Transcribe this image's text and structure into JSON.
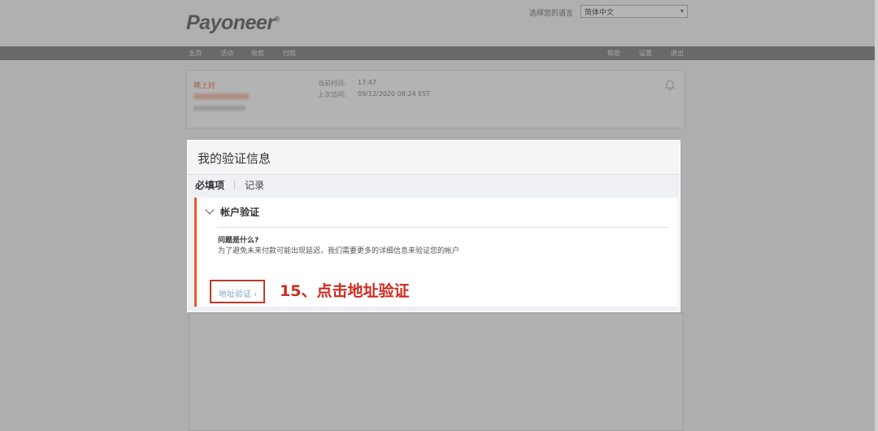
{
  "header": {
    "logo": "Payoneer",
    "logo_mark": "®",
    "language_label": "选择您的语言",
    "language_selected": "简体中文"
  },
  "nav": {
    "left": [
      "主页",
      "活动",
      "收款",
      "付款"
    ],
    "right": [
      "帮助",
      "设置",
      "退出"
    ]
  },
  "user_card": {
    "greeting": "晚上好",
    "current_time_label": "当前时间:",
    "current_time": "17:47",
    "last_visit_label": "上次访问:",
    "last_visit": "09/12/2020 08:24 EST"
  },
  "modal": {
    "title": "我的验证信息",
    "tabs": [
      "必填项",
      "记录"
    ],
    "section_title": "帐户验证",
    "question": "问题是什么?",
    "description": "为了避免未来付款可能出现延迟，我们需要更多的详细信息来验证您的帐户",
    "address_button": "地址验证 ›",
    "annotation": "15、点击地址验证"
  },
  "colors": {
    "accent": "#e8592a",
    "annotation": "#d12a1f",
    "link": "#7fa6c7"
  }
}
